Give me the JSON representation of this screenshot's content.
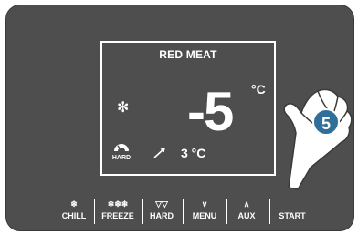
{
  "display": {
    "program_name": "RED MEAT",
    "set_temperature": "-5",
    "set_unit": "°C",
    "probe_temperature": "3 °C",
    "hard_label": "HARD"
  },
  "buttons": {
    "chill": {
      "glyph": "❄",
      "label": "CHILL"
    },
    "freeze": {
      "glyph": "❄❄❄",
      "label": "FREEZE"
    },
    "hard": {
      "glyph": "▽▽",
      "label": "HARD"
    },
    "menu": {
      "glyph": "∨",
      "label": "MENU"
    },
    "aux": {
      "glyph": "∧",
      "label": "AUX"
    },
    "start": {
      "label": "START"
    }
  },
  "step_badge": "5",
  "colors": {
    "panel": "#4e4e4e",
    "badge": "#2f6f9a",
    "text": "#ffffff"
  }
}
